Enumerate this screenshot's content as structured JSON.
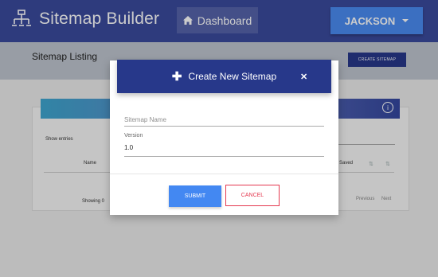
{
  "app": {
    "title": "Sitemap Builder",
    "logo_icon": "sitemap-icon"
  },
  "nav": {
    "dashboard_label": "Dashboard",
    "dashboard_icon": "home-icon",
    "user_label": "JACKSON",
    "user_icon": "caret-down-icon"
  },
  "page": {
    "title": "Sitemap Listing",
    "create_button": "CREATE SITEMAP"
  },
  "table": {
    "show_entries": "Show entries",
    "columns": [
      "Name",
      "Saved"
    ],
    "showing_text": "Showing 0",
    "pagination": [
      "Previous",
      "Next"
    ],
    "info_icon": "info-icon"
  },
  "modal": {
    "title": "Create New Sitemap",
    "title_icon": "plus-icon",
    "close_icon": "close-icon",
    "name_placeholder": "Sitemap Name",
    "version_label": "Version",
    "version_value": "1.0",
    "submit_label": "SUBMIT",
    "cancel_label": "CANCEL"
  },
  "colors": {
    "navbar": "#3a4a9d",
    "primary_dark": "#27388a",
    "accent_blue": "#4388f2",
    "danger": "#e53950"
  }
}
